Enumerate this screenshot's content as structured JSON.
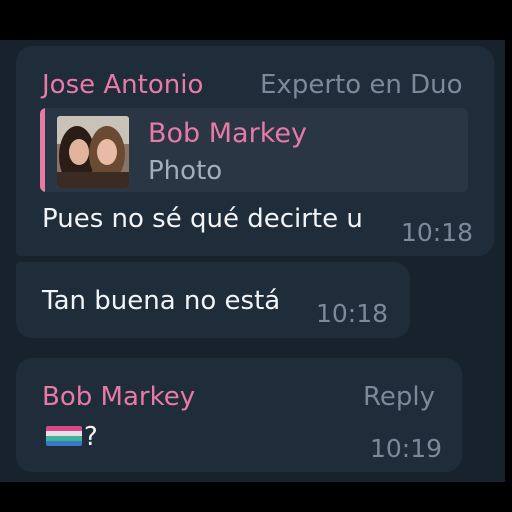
{
  "messages": [
    {
      "sender": "Jose Antonio",
      "role": "Experto en Duo",
      "reply_to": {
        "name": "Bob Markey",
        "type": "Photo"
      },
      "text": "Pues no sé qué decirte u",
      "time": "10:18"
    },
    {
      "text": "Tan buena no está",
      "time": "10:18"
    },
    {
      "sender": "Bob Markey",
      "action": "Reply",
      "emoji": "flag-emoji",
      "text": "?",
      "time": "10:19"
    }
  ],
  "colors": {
    "background": "#18222d",
    "bubble": "#1f2c3a",
    "accent": "#e77aa6",
    "muted": "#7b8998",
    "text": "#f2f4f6"
  }
}
